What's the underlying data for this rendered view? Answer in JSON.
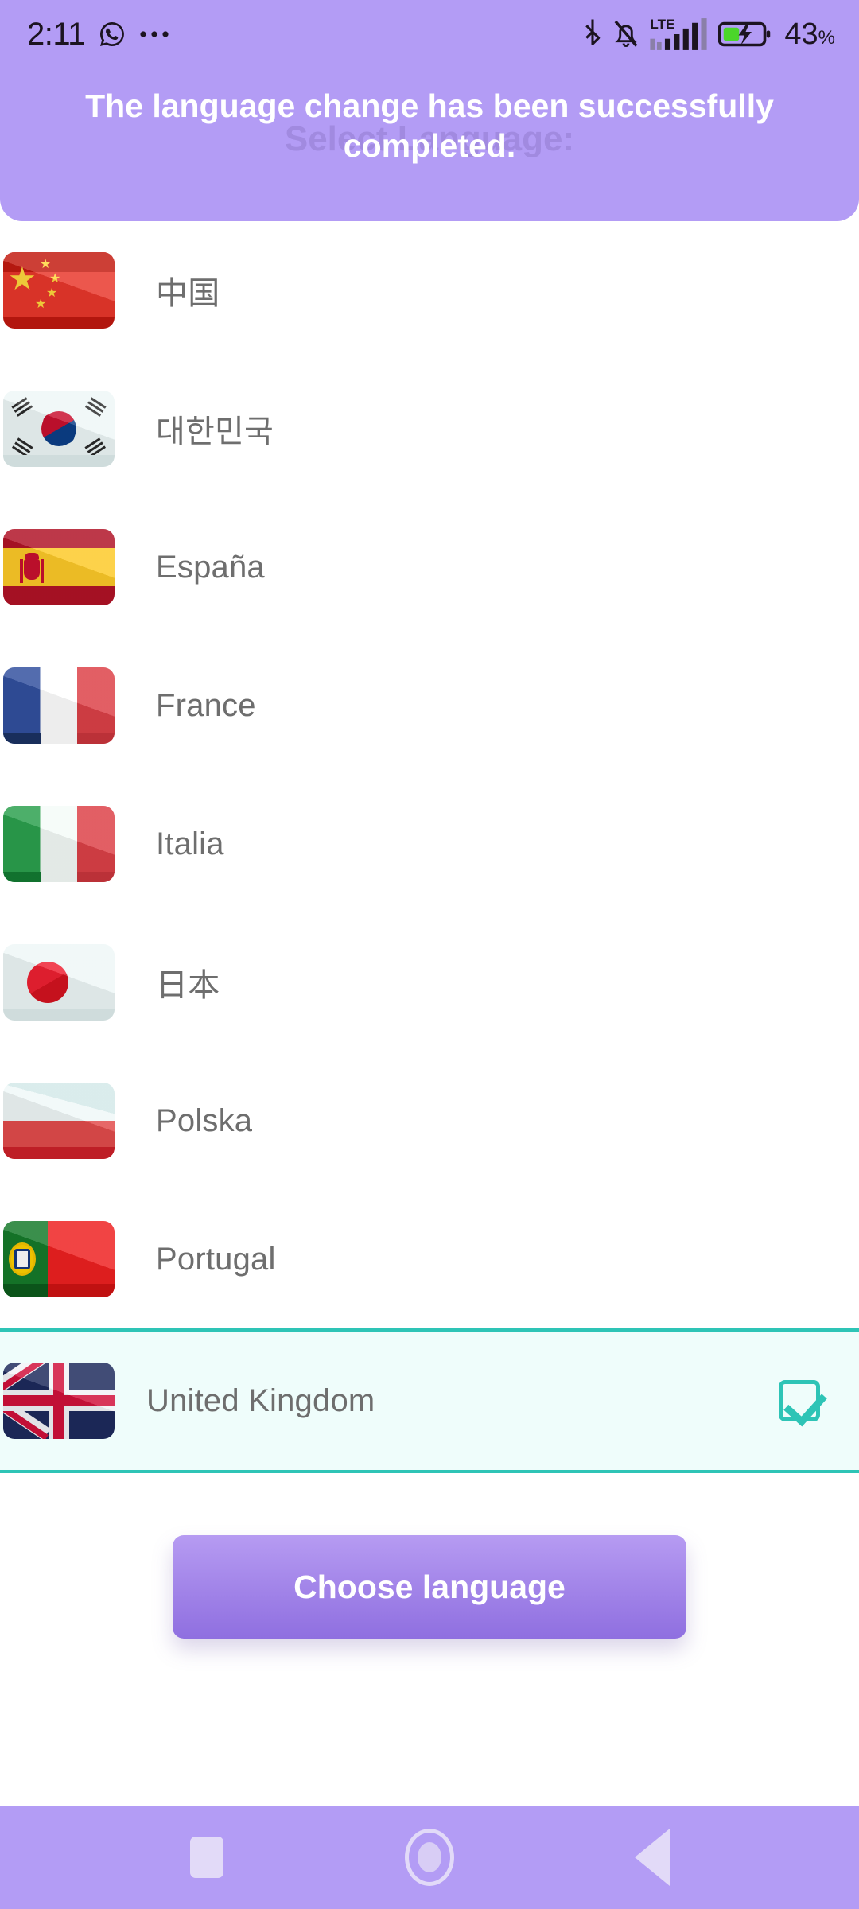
{
  "statusbar": {
    "time": "2:11",
    "icons": [
      "whatsapp-icon",
      "more-icon",
      "bluetooth-icon",
      "mute-bell-icon",
      "lte-signal-icon",
      "battery-charging-icon"
    ],
    "network_label": "LTE",
    "battery_percent": "43",
    "battery_symbol": "%"
  },
  "header": {
    "title": "Select Language:",
    "background_color": "#b39cf5"
  },
  "toast": {
    "message": "The language change has been successfully completed."
  },
  "list": {
    "items": [
      {
        "name": "中国",
        "flag": "china-flag",
        "selected": false
      },
      {
        "name": "대한민국",
        "flag": "south-korea-flag",
        "selected": false
      },
      {
        "name": "España",
        "flag": "spain-flag",
        "selected": false
      },
      {
        "name": "France",
        "flag": "france-flag",
        "selected": false
      },
      {
        "name": "Italia",
        "flag": "italy-flag",
        "selected": false
      },
      {
        "name": "日本",
        "flag": "japan-flag",
        "selected": false
      },
      {
        "name": "Polska",
        "flag": "poland-flag",
        "selected": false
      },
      {
        "name": "Portugal",
        "flag": "portugal-flag",
        "selected": false
      },
      {
        "name": "United Kingdom",
        "flag": "united-kingdom-flag",
        "selected": true
      }
    ],
    "selected_accent_color": "#2ec4b6",
    "selected_background_color": "#effdfb"
  },
  "cta": {
    "label": "Choose language",
    "gradient_top": "#b69bf2",
    "gradient_bottom": "#8f6fe0"
  },
  "navbar": {
    "recents_label": "Recents",
    "home_label": "Home",
    "back_label": "Back",
    "background_color": "#b39cf5"
  }
}
